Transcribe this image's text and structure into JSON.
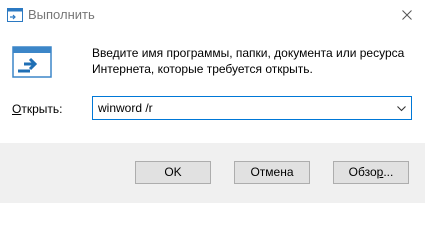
{
  "window": {
    "title": "Выполнить",
    "app_icon": "run-dialog-icon",
    "close_icon": "close-icon"
  },
  "body": {
    "run_icon": "run-program-icon",
    "description": "Введите имя программы, папки, документа или ресурса Интернета, которые требуется открыть."
  },
  "open_field": {
    "label_underlined": "О",
    "label_rest": "ткрыть:",
    "value": "winword /r",
    "dropdown_icon": "chevron-down-icon"
  },
  "buttons": {
    "ok": "OK",
    "cancel": "Отмена",
    "browse_before": "Обзо",
    "browse_underlined": "р",
    "browse_after": "..."
  },
  "colors": {
    "focus_border": "#0078d7",
    "footer_bg": "#f0f0f0",
    "button_bg": "#e1e1e1",
    "button_border": "#adadad",
    "title_text": "#777777"
  }
}
